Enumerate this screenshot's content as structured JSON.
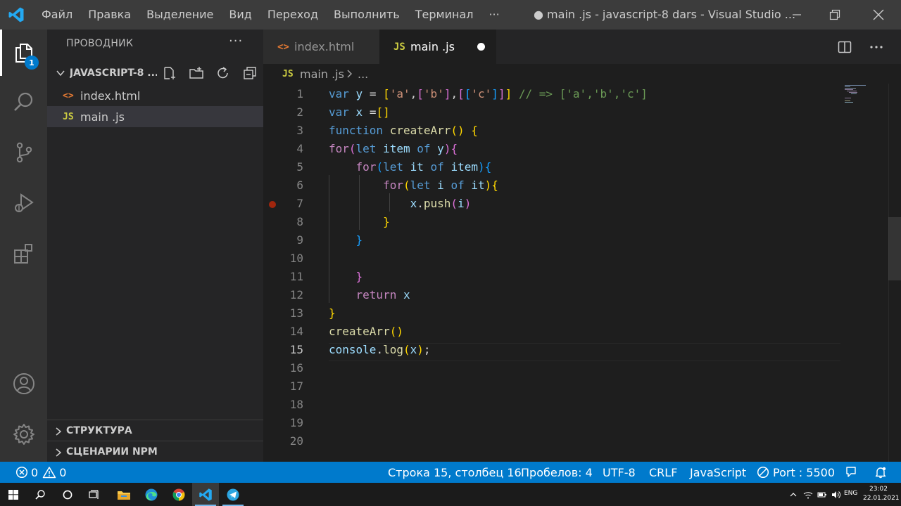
{
  "titlebar": {
    "menu": [
      "Файл",
      "Правка",
      "Выделение",
      "Вид",
      "Переход",
      "Выполнить",
      "Терминал",
      "···"
    ],
    "title": "● main .js - javascript-8 dars - Visual Studio ..."
  },
  "activitybar": {
    "explorer_badge": "1",
    "icons": [
      "explorer-icon",
      "search-icon",
      "source-control-icon",
      "run-debug-icon",
      "extensions-icon",
      "account-icon",
      "settings-gear-icon"
    ]
  },
  "sidebar": {
    "title": "ПРОВОДНИК",
    "more": "···",
    "folder": "JAVASCRIPT-8 ...",
    "files": [
      {
        "icon": "<>",
        "name": "index.html",
        "icon_color": "#e37933"
      },
      {
        "icon": "JS",
        "name": "main .js",
        "icon_color": "#cbcb41"
      }
    ],
    "sections": [
      "СТРУКТУРА",
      "СЦЕНАРИИ NPM"
    ]
  },
  "tabs": [
    {
      "icon": "<>",
      "label": "index.html",
      "icon_color": "#e37933"
    },
    {
      "icon": "JS",
      "label": "main .js",
      "icon_color": "#cbcb41"
    }
  ],
  "breadcrumb": {
    "icon": "JS",
    "file": "main .js",
    "more": "..."
  },
  "editor": {
    "line_numbers": [
      "1",
      "2",
      "3",
      "4",
      "5",
      "6",
      "7",
      "8",
      "9",
      "10",
      "11",
      "12",
      "13",
      "14",
      "15",
      "16",
      "17",
      "18",
      "19",
      "20"
    ],
    "current_line": "15",
    "lines": [
      [
        [
          "k",
          "var"
        ],
        [
          "p",
          " "
        ],
        [
          "v",
          "y"
        ],
        [
          "p",
          " = "
        ],
        [
          "b1",
          "["
        ],
        [
          "s",
          "'a'"
        ],
        [
          "p",
          ","
        ],
        [
          "b2",
          "["
        ],
        [
          "s",
          "'b'"
        ],
        [
          "b2",
          "]"
        ],
        [
          "p",
          ","
        ],
        [
          "b2",
          "["
        ],
        [
          "b3",
          "["
        ],
        [
          "s",
          "'c'"
        ],
        [
          "b3",
          "]"
        ],
        [
          "b2",
          "]"
        ],
        [
          "b1",
          "]"
        ],
        [
          "p",
          " "
        ],
        [
          "cm",
          "// => ['a','b','c']"
        ]
      ],
      [
        [
          "k",
          "var"
        ],
        [
          "p",
          " "
        ],
        [
          "v",
          "x"
        ],
        [
          "p",
          " ="
        ],
        [
          "b1",
          "[]"
        ]
      ],
      [
        [
          "k",
          "function"
        ],
        [
          "p",
          " "
        ],
        [
          "f",
          "createArr"
        ],
        [
          "b1",
          "()"
        ],
        [
          "p",
          " "
        ],
        [
          "b1",
          "{"
        ]
      ],
      [
        [
          "c",
          "for"
        ],
        [
          "b2",
          "("
        ],
        [
          "k",
          "let"
        ],
        [
          "p",
          " "
        ],
        [
          "v",
          "item"
        ],
        [
          "p",
          " "
        ],
        [
          "k",
          "of"
        ],
        [
          "p",
          " "
        ],
        [
          "v",
          "y"
        ],
        [
          "b2",
          ")"
        ],
        [
          "b2",
          "{"
        ]
      ],
      [
        [
          "p",
          "    "
        ],
        [
          "c",
          "for"
        ],
        [
          "b3",
          "("
        ],
        [
          "k",
          "let"
        ],
        [
          "p",
          " "
        ],
        [
          "v",
          "it"
        ],
        [
          "p",
          " "
        ],
        [
          "k",
          "of"
        ],
        [
          "p",
          " "
        ],
        [
          "v",
          "item"
        ],
        [
          "b3",
          ")"
        ],
        [
          "b3",
          "{"
        ]
      ],
      [
        [
          "p",
          "        "
        ],
        [
          "c",
          "for"
        ],
        [
          "b1",
          "("
        ],
        [
          "k",
          "let"
        ],
        [
          "p",
          " "
        ],
        [
          "v",
          "i"
        ],
        [
          "p",
          " "
        ],
        [
          "k",
          "of"
        ],
        [
          "p",
          " "
        ],
        [
          "v",
          "it"
        ],
        [
          "b1",
          ")"
        ],
        [
          "b1",
          "{"
        ]
      ],
      [
        [
          "p",
          "            "
        ],
        [
          "v",
          "x"
        ],
        [
          "p",
          "."
        ],
        [
          "f",
          "push"
        ],
        [
          "b2",
          "("
        ],
        [
          "v",
          "i"
        ],
        [
          "b2",
          ")"
        ]
      ],
      [
        [
          "p",
          "        "
        ],
        [
          "b1",
          "}"
        ]
      ],
      [
        [
          "p",
          "    "
        ],
        [
          "b3",
          "}"
        ]
      ],
      [
        [
          "p",
          ""
        ]
      ],
      [
        [
          "p",
          "    "
        ],
        [
          "b2",
          "}"
        ]
      ],
      [
        [
          "p",
          "    "
        ],
        [
          "c",
          "return"
        ],
        [
          "p",
          " "
        ],
        [
          "v",
          "x"
        ]
      ],
      [
        [
          "b1",
          "}"
        ]
      ],
      [
        [
          "f",
          "createArr"
        ],
        [
          "b1",
          "()"
        ]
      ],
      [
        [
          "v",
          "console"
        ],
        [
          "p",
          "."
        ],
        [
          "f",
          "log"
        ],
        [
          "b1",
          "("
        ],
        [
          "v",
          "x"
        ],
        [
          "b1",
          ")"
        ],
        [
          "p",
          ";"
        ]
      ],
      [
        [
          "p",
          ""
        ]
      ],
      [
        [
          "p",
          ""
        ]
      ],
      [
        [
          "p",
          ""
        ]
      ],
      [
        [
          "p",
          ""
        ]
      ],
      [
        [
          "p",
          ""
        ]
      ]
    ]
  },
  "statusbar": {
    "errors": "0",
    "warnings": "0",
    "position": "Строка 15, столбец 16",
    "spaces": "Пробелов: 4",
    "encoding": "UTF-8",
    "eol": "CRLF",
    "language": "JavaScript",
    "port": "Port : 5500"
  },
  "taskbar": {
    "lang": "ENG",
    "time": "23:02",
    "date": "22.01.2021"
  }
}
